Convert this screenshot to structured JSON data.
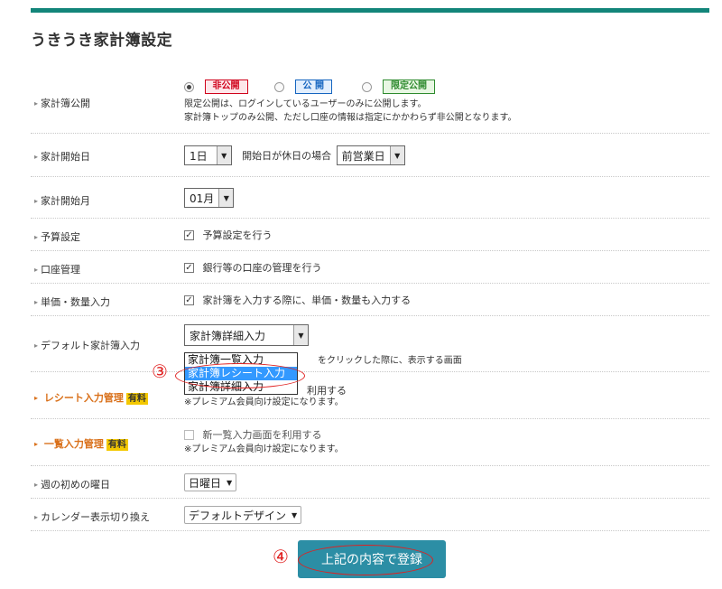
{
  "page": {
    "title": "うきうき家計簿設定"
  },
  "colors": {
    "accent": "#13857a",
    "paid_badge": "#f3c800",
    "annotation": "#e02020",
    "submit_bg": "#2c8ea5"
  },
  "rows": {
    "public": {
      "label": "家計簿公開",
      "options": [
        "非公開",
        "公 開",
        "限定公開"
      ],
      "selected": "非公開",
      "note1": "限定公開は、ログインしているユーザーのみに公開します。",
      "note2": "家計簿トップのみ公開、ただし口座の情報は指定にかかわらず非公開となります。"
    },
    "start_day": {
      "label": "家計開始日",
      "value": "1日",
      "holiday_label": "開始日が休日の場合",
      "holiday_value": "前営業日"
    },
    "start_month": {
      "label": "家計開始月",
      "value": "01月"
    },
    "budget": {
      "label": "予算設定",
      "text": "予算設定を行う",
      "checked": true
    },
    "account": {
      "label": "口座管理",
      "text": "銀行等の口座の管理を行う",
      "checked": true
    },
    "unit_price": {
      "label": "単価・数量入力",
      "text": "家計簿を入力する際に、単価・数量も入力する",
      "checked": true
    },
    "default_input": {
      "label": "デフォルト家計簿入力",
      "value": "家計簿詳細入力",
      "note_suffix": "をクリックした際に、表示する画面",
      "options": [
        "家計簿一覧入力",
        "家計簿レシート入力",
        "家計簿詳細入力"
      ],
      "highlighted": "家計簿レシート入力"
    },
    "receipt": {
      "label": "レシート入力管理",
      "badge": "有料",
      "text_tail": "利用する",
      "note": "※プレミアム会員向け設定になります。"
    },
    "list_input": {
      "label": "一覧入力管理",
      "badge": "有料",
      "text": "新一覧入力画面を利用する",
      "note": "※プレミアム会員向け設定になります。"
    },
    "week_start": {
      "label": "週の初めの曜日",
      "value": "日曜日"
    },
    "calendar": {
      "label": "カレンダー表示切り換え",
      "value": "デフォルトデザイン"
    }
  },
  "annotations": {
    "step3": "③",
    "step4": "④"
  },
  "submit": {
    "label": "上記の内容で登録"
  }
}
